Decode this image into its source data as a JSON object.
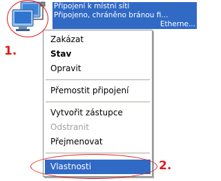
{
  "connection": {
    "name": "Připojení k místní síti",
    "status": "Připojeno, chráněno bránou fi...",
    "device": "Etherne..."
  },
  "context_menu": {
    "items": [
      {
        "label": "Zakázat"
      },
      {
        "label": "Stav"
      },
      {
        "label": "Opravit"
      },
      {
        "label": "Přemostit připojení"
      },
      {
        "label": "Vytvořit zástupce"
      },
      {
        "label": "Odstranit"
      },
      {
        "label": "Přejmenovat"
      },
      {
        "label": "Vlastnosti"
      }
    ]
  },
  "annotations": {
    "step1": "1.",
    "step2": "2."
  },
  "colors": {
    "selection": "#316ac5",
    "annotation": "#e31818"
  }
}
